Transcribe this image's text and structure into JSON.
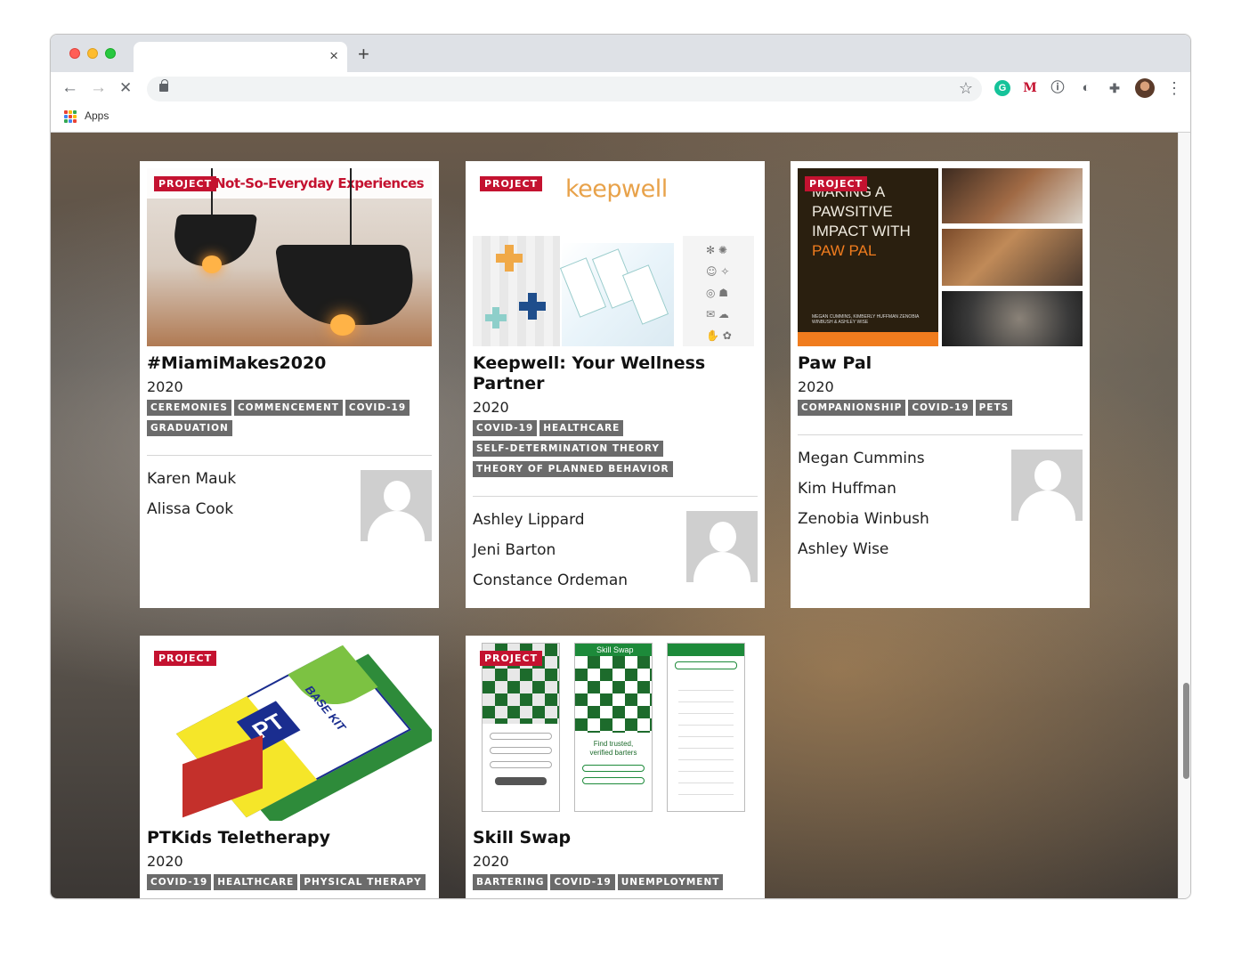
{
  "browser": {
    "tab_close": "×",
    "new_tab": "+",
    "back": "←",
    "forward": "→",
    "stop": "✕",
    "bookmark_star": "☆",
    "menu": "⋮",
    "bookmarks_bar": {
      "apps_label": "Apps"
    },
    "extensions": [
      {
        "name": "grammarly-icon",
        "glyph": "G",
        "color": "#15c39a"
      },
      {
        "name": "miami-m-icon",
        "glyph": "M",
        "color": "#c41230"
      },
      {
        "name": "info-extension-icon",
        "glyph": "ⓘ",
        "color": "#5f6368"
      },
      {
        "name": "dark-mode-icon",
        "glyph": "◐",
        "color": "#5f6368"
      },
      {
        "name": "puzzle-extensions-icon",
        "glyph": "✚",
        "color": "#5f6368"
      }
    ]
  },
  "cards": [
    {
      "badge": "PROJECT",
      "image_caption": "Not-So-Everyday Experiences",
      "title": "#MiamiMakes2020",
      "year": "2020",
      "tags": [
        "CEREMONIES",
        "COMMENCEMENT",
        "COVID-19",
        "GRADUATION"
      ],
      "authors": [
        "Karen Mauk",
        "Alissa Cook"
      ]
    },
    {
      "badge": "PROJECT",
      "image_caption": "keepwell",
      "title": "Keepwell: Your Wellness Partner",
      "year": "2020",
      "tags": [
        "COVID-19",
        "HEALTHCARE",
        "SELF-DETERMINATION THEORY",
        "THEORY OF PLANNED BEHAVIOR"
      ],
      "authors": [
        "Ashley Lippard",
        "Jeni Barton",
        "Constance Ordeman"
      ]
    },
    {
      "badge": "PROJECT",
      "image_caption": "MAKING A PAWSITIVE IMPACT WITH PAW PAL",
      "image_caption_accent": "PAW PAL",
      "image_credits": "MEGAN CUMMINS, KIMBERLY HUFFMAN ZENOBIA WINBUSH & ASHLEY WISE",
      "title": "Paw Pal",
      "year": "2020",
      "tags": [
        "COMPANIONSHIP",
        "COVID-19",
        "PETS"
      ],
      "authors": [
        "Megan Cummins",
        "Kim Huffman",
        "Zenobia Winbush",
        "Ashley Wise"
      ]
    },
    {
      "badge": "PROJECT",
      "image_caption": "BASE KIT",
      "title": "PTKids Teletherapy",
      "year": "2020",
      "tags": [
        "COVID-19",
        "HEALTHCARE",
        "PHYSICAL THERAPY"
      ],
      "authors": []
    },
    {
      "badge": "PROJECT",
      "image_caption": "Skill Swap",
      "image_tagline": "Find trusted, verified barters",
      "title": "Skill Swap",
      "year": "2020",
      "tags": [
        "BARTERING",
        "COVID-19",
        "UNEMPLOYMENT"
      ],
      "authors": []
    }
  ]
}
